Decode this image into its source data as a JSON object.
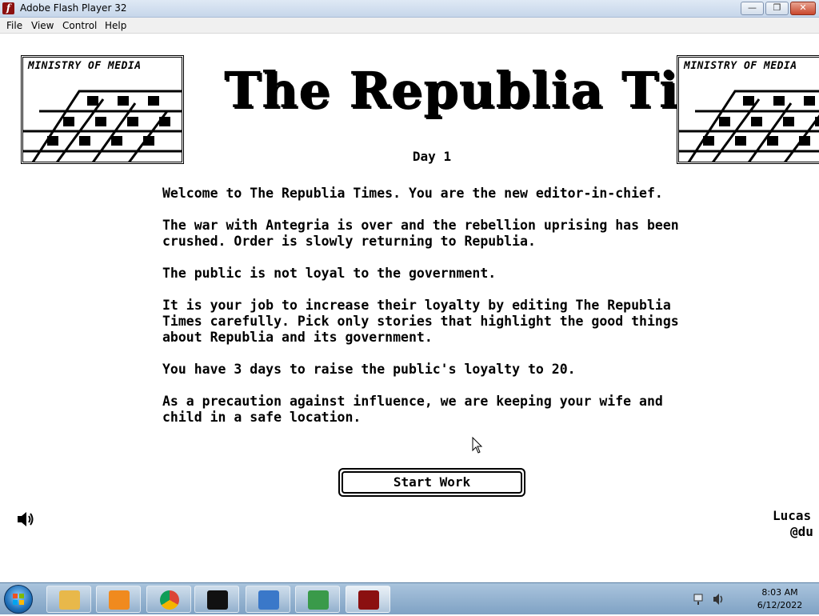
{
  "window": {
    "title": "Adobe Flash Player 32",
    "controls": {
      "minimize": "—",
      "maximize": "❐",
      "close": "✕"
    }
  },
  "menu": [
    "File",
    "View",
    "Control",
    "Help"
  ],
  "game": {
    "ministry_label": "MINISTRY OF MEDIA",
    "masthead": "The Republia Times",
    "day": "Day 1",
    "paragraphs": [
      "Welcome to The Republia Times. You are the new editor-in-chief.",
      "The war with Antegria is over and the rebellion uprising has been crushed. Order is slowly returning to Republia.",
      "The public is not loyal to the government.",
      "It is your job to increase their loyalty by editing The Republia Times carefully. Pick only stories that highlight the good things about Republia and its government.",
      "You have 3 days to raise the public's loyalty to 20.",
      "As a precaution against influence, we are keeping your wife and child in a safe location."
    ],
    "start_button": "Start Work",
    "credit_name": "Lucas",
    "credit_handle": "@du"
  },
  "taskbar": {
    "pinned": [
      {
        "name": "explorer-taskbar-button",
        "icon": "folder-icon",
        "color": "#e8b84a"
      },
      {
        "name": "media-player-taskbar-button",
        "icon": "media-player-icon",
        "color": "#f08a1e"
      },
      {
        "name": "chrome-taskbar-button",
        "icon": "chrome-icon",
        "color": "#db4437"
      },
      {
        "name": "cmd-taskbar-button",
        "icon": "command-prompt-icon",
        "color": "#111111"
      },
      {
        "name": "control-panel-taskbar-button",
        "icon": "control-panel-icon",
        "color": "#3a78c9"
      },
      {
        "name": "network-taskbar-button",
        "icon": "network-icon",
        "color": "#3a9a4a"
      },
      {
        "name": "flash-taskbar-button",
        "icon": "flash-player-icon",
        "color": "#8b1010"
      }
    ],
    "time": "8:03 AM",
    "date": "6/12/2022"
  }
}
